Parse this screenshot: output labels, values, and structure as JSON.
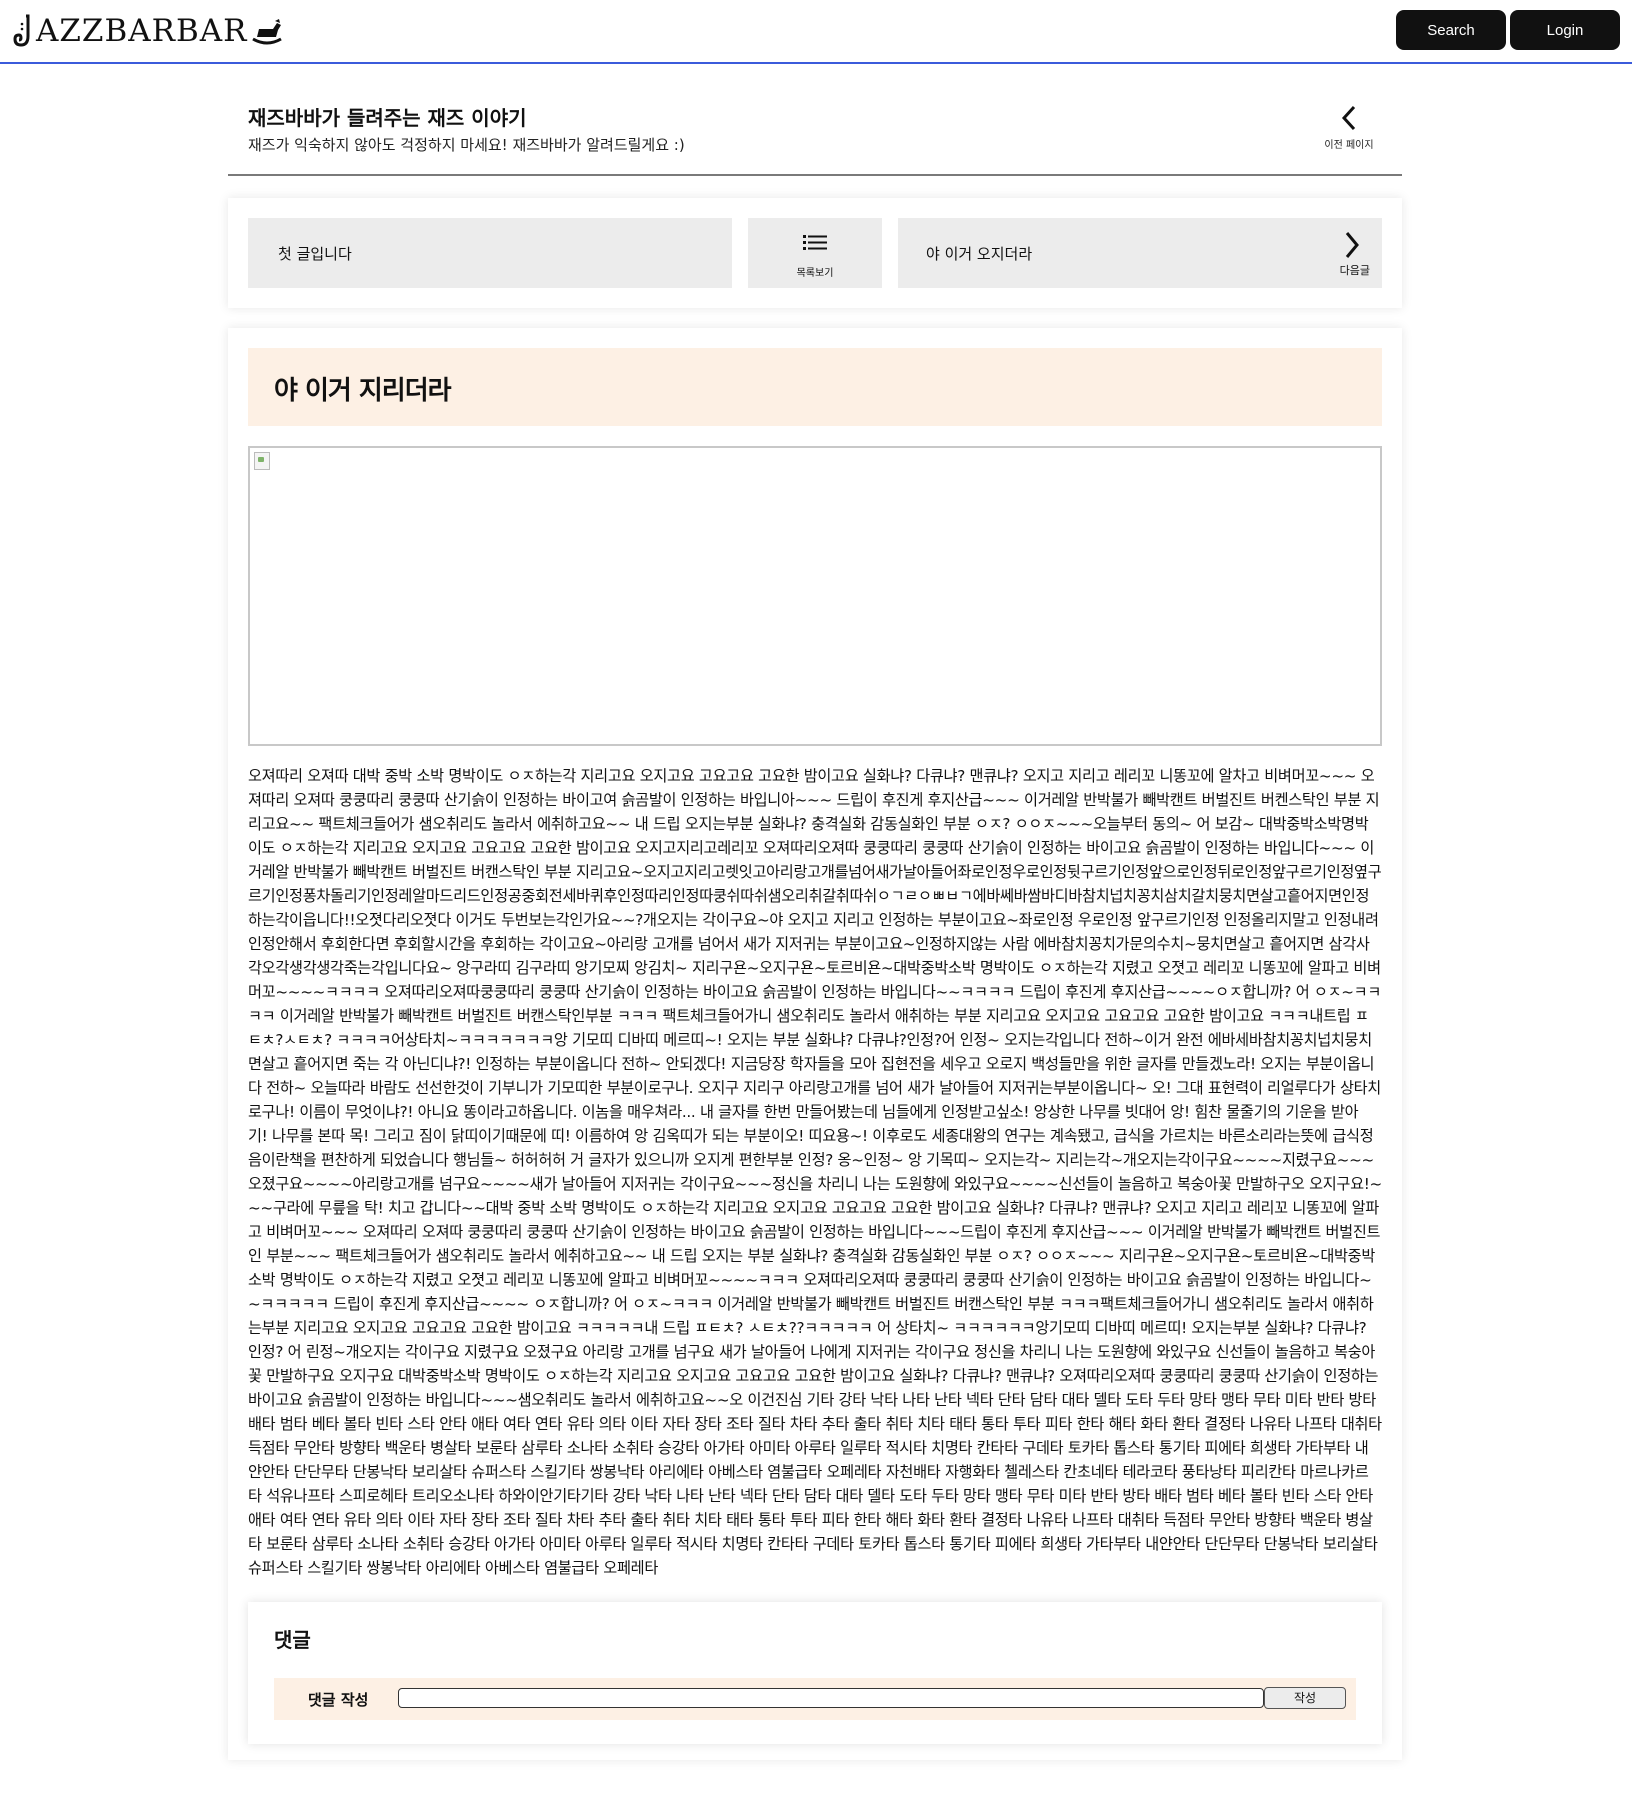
{
  "header": {
    "logo_text": "AZZBARBAR",
    "search_label": "Search",
    "login_label": "Login"
  },
  "page": {
    "title": "재즈바바가 들려주는 재즈 이야기",
    "subtitle": "재즈가 익숙하지 않아도 걱정하지 마세요! 재즈바바가 알려드릴게요 :)",
    "back_label": "이전 페이지"
  },
  "nav": {
    "prev_title": "첫 글입니다",
    "list_label": "목록보기",
    "next_title": "야 이거 오지더라",
    "next_label": "다음글"
  },
  "post": {
    "title": "야 이거 지리더라",
    "body": "오져따리 오져따 대박 중박 소박 명박이도 ㅇㅈ하는각 지리고요 오지고요 고요고요 고요한 밤이고요 실화냐? 다큐냐? 맨큐냐? 오지고 지리고 레리꼬 니똥꼬에 알차고 비벼머꼬~~~ 오져따리 오져따 쿵쿵따리 쿵쿵따 산기슭이 인정하는 바이고여 슭곰발이 인정하는 바입니아~~~ 드립이 후진게 후지산급~~~ 이거레알 반박불가 빼박캔트 버벌진트 버켄스탁인 부분 지리고요~~ 팩트체크들어가 샘오취리도 놀라서 에취하고요~~ 내 드립 오지는부분 실화냐? 충격실화 감동실화인 부분 ㅇㅈ? ㅇㅇㅈ~~~오늘부터 동의~ 어 보감~ 대박중박소박명박이도 ㅇㅈ하는각 지리고요 오지고요 고요고요 고요한 밤이고요 오지고지리고레리꼬 오져따리오져따 쿵쿵따리 쿵쿵따 산기슭이 인정하는 바이고요 슭곰발이 인정하는 바입니다~~~ 이거레알 반박불가 빼박캔트 버벌진트 버캔스탁인 부분 지리고요~오지고지리고렛잇고아리랑고개를넘어새가날아들어좌로인정우로인정뒷구르기인정앞으로인정뒤로인정앞구르기인정옆구르기인정퐁차돌리기인정레알마드리드인정공중회전세바퀴후인정따리인정따쿵쉬따쉬샘오리취갈취따쉬ㅇㄱㄹㅇㅃㅂㄱ에바쎄바쌈바디바참치넙치꽁치삼치갈치뭉치면살고흩어지면인정하는각이읍니다!!오졋다리오졋다 이거도 두번보는각인가요~~?개오지는 각이구요~야 오지고 지리고 인정하는 부분이고요~좌로인정 우로인정 앞구르기인정 인정올리지말고 인정내려 인정안해서 후회한다면 후회할시간을 후회하는 각이고요~아리랑 고개를 넘어서 새가 지저귀는 부분이고요~인정하지않는 사람 에바참치꽁치가문의수치~뭉치면살고 흩어지면 삼각사각오각생각생각죽는각입니다요~ 앙구라띠 김구라띠 앙기모찌 앙김치~ 지리구욘~오지구욘~토르비욘~대박중박소박 명박이도 ㅇㅈ하는각 지렸고 오졋고 레리꼬 니똥꼬에 알파고 비벼머꼬~~~~ㅋㅋㅋㅋ 오져따리오져따쿵쿵따리 쿵쿵따 산기슭이 인정하는 바이고요 슭곰발이 인정하는 바입니다~~ㅋㅋㅋㅋ 드립이 후진게 후지산급~~~~ㅇㅈ합니까? 어 ㅇㅈ~ㅋㅋㅋㅋ 이거레알 반박불가 빼박캔트 버벌진트 버캔스탁인부분 ㅋㅋㅋ 팩트체크들어가니 샘오취리도 놀라서 애취하는 부분 지리고요 오지고요 고요고요 고요한 밤이고요 ㅋㅋㅋ내트립 ㅍㅌㅊ?ㅅㅌㅊ? ㅋㅋㅋㅋ어상타치~ㅋㅋㅋㅋㅋㅋㅋ앙 기모띠 디바띠 메르띠~! 오지는 부분 실화냐? 다큐냐?인정?어 인정~ 오지는각입니다 전하~이거 완전 에바세바참치꽁치넙치뭉치면살고 흩어지면 죽는 각 아닌디냐?! 인정하는 부분이옵니다 전하~ 안되겠다! 지금당장 학자들을 모아 집현전을 세우고 오로지 백성들만을 위한 글자를 만들겠노라! 오지는 부분이옵니다 전하~ 오늘따라 바람도 선선한것이 기부니가 기모띠한 부분이로구나. 오지구 지리구 아리랑고개를 넘어 새가 날아들어 지저귀는부분이옵니다~ 오! 그대 표현력이 리얼루다가 상타치로구나! 이름이 무엇이냐?! 아니요 똥이라고하옵니다. 이놈을 매우쳐라... 내 글자를 한번 만들어봤는데 님들에게 인정받고싶소! 앙상한 나무를 빗대어 앙! 힘찬 물줄기의 기운을 받아 기! 나무를 본따 목! 그리고 짐이 닭띠이기때문에 띠! 이름하여 앙 김옥띠가 되는 부분이오! 띠요용~! 이후로도 세종대왕의 연구는 계속됐고, 급식을 가르치는 바른소리라는뜻에 급식정음이란책을 편찬하게 되었습니다 행님들~ 허허허허 거 글자가 있으니까 오지게 편한부분 인정? 옹~인정~ 앙 기목띠~ 오지는각~ 지리는각~개오지는각이구요~~~~지렸구요~~~오졌구요~~~~아리랑고개를 넘구요~~~~새가 날아들어 지저귀는 각이구요~~~정신을 차리니 나는 도원향에 와있구요~~~~신선들이 놀음하고 복숭아꽃 만발하구오 오지구요!~~~구라에 무릎을 탁! 치고 갑니다~~대박 중박 소박 명박이도 ㅇㅈ하는각 지리고요 오지고요 고요고요 고요한 밤이고요 실화냐? 다큐냐? 맨큐냐? 오지고 지리고 레리꼬 니똥꼬에 알파고 비벼머꼬~~~ 오져따리 오져따 쿵쿵따리 쿵쿵따 산기슭이 인정하는 바이고요 슭곰발이 인정하는 바입니다~~~드립이 후진게 후지산급~~~ 이거레알 반박불가 빼박캔트 버벌진트인 부분~~~ 팩트체크들어가 샘오취리도 놀라서 에취하고요~~ 내 드립 오지는 부분 실화냐? 충격실화 감동실화인 부분 ㅇㅈ? ㅇㅇㅈ~~~ 지리구욘~오지구욘~토르비욘~대박중박소박 명박이도 ㅇㅈ하는각 지렸고 오졋고 레리꼬 니똥꼬에 알파고 비벼머꼬~~~~ㅋㅋㅋ 오져따리오져따 쿵쿵따리 쿵쿵따 산기슭이 인정하는 바이고요 슭곰발이 인정하는 바입니다~~ㅋㅋㅋㅋㅋ 드립이 후진게 후지산급~~~~ ㅇㅈ합니까? 어 ㅇㅈ~ㅋㅋㅋ 이거레알 반박불가 빼박캔트 버벌진트 버캔스탁인 부분 ㅋㅋㅋ팩트체크들어가니 샘오취리도 놀라서 애취하는부분 지리고요 오지고요 고요고요 고요한 밤이고요 ㅋㅋㅋㅋㅋ내 드립 ㅍㅌㅊ? ㅅㅌㅊ??ㅋㅋㅋㅋㅋ 어 상타치~ ㅋㅋㅋㅋㅋㅋ앙기모띠 디바띠 메르띠! 오지는부분 실화냐? 다큐냐? 인정? 어 린정~개오지는 각이구요 지렸구요 오졌구요 아리랑 고개를 넘구요 새가 날아들어 나에게 지저귀는 각이구요 정신을 차리니 나는 도원향에 와있구요 신선들이 놀음하고 복숭아꽃 만발하구요 오지구요 대박중박소박 명박이도 ㅇㅈ하는각 지리고요 오지고요 고요고요 고요한 밤이고요 실화냐? 다큐냐? 맨큐냐? 오져따리오져따 쿵쿵따리 쿵쿵따 산기슭이 인정하는 바이고요 슭곰발이 인정하는 바입니다~~~샘오취리도 놀라서 에취하고요~~오 이건진심 기타 강타 낙타 나타 난타 넥타 단타 담타 대타 델타 도타 두타 망타 맹타 무타 미타 반타 방타 배타 범타 베타 볼타 빈타 스타 안타 애타 여타 연타 유타 의타 이타 자타 장타 조타 질타 차타 추타 출타 취타 치타 태타 통타 투타 피타 한타 해타 화타 환타 결정타 나유타 나프타 대취타 득점타 무안타 방향타 백운타 병살타 보룬타 삼루타 소나타 소취타 승강타 아가타 아미타 아루타 일루타 적시타 치명타 칸타타 구데타 토카타 톱스타 통기타 피에타 희생타 가타부타 내얀안타 단단무타 단봉낙타 보리살타 슈퍼스타 스킬기타 쌍봉낙타 아리에타 아베스타 염불급타 오페레타 자천배타 자행화타 첼레스타 칸초네타 테라코타 풍타낭타 피리칸타 마르나카르타 석유나프타 스피로헤타 트리오소나타 하와이안기타기타 강타 낙타 나타 난타 넥타 단타 담타 대타 델타 도타 두타 망타 맹타 무타 미타 반타 방타 배타 범타 베타 볼타 빈타 스타 안타 애타 여타 연타 유타 의타 이타 자타 장타 조타 질타 차타 추타 출타 취타 치타 태타 통타 투타 피타 한타 해타 화타 환타 결정타 나유타 나프타 대취타 득점타 무안타 방향타 백운타 병살타 보룬타 삼루타 소나타 소취타 승강타 아가타 아미타 아루타 일루타 적시타 치명타 칸타타 구데타 토카타 톱스타 통기타 피에타 희생타 가타부타 내얀안타 단단무타 단봉낙타 보리살타 슈퍼스타 스킬기타 쌍봉낙타 아리에타 아베스타 염불급타 오페레타"
  },
  "comments": {
    "heading": "댓글",
    "write_label": "댓글 작성",
    "input_placeholder": "",
    "submit_label": "작성"
  },
  "colors": {
    "accent_line": "#3b5bdb",
    "title_bar_bg": "#fdf0e4",
    "nav_box_bg": "#ececec"
  }
}
